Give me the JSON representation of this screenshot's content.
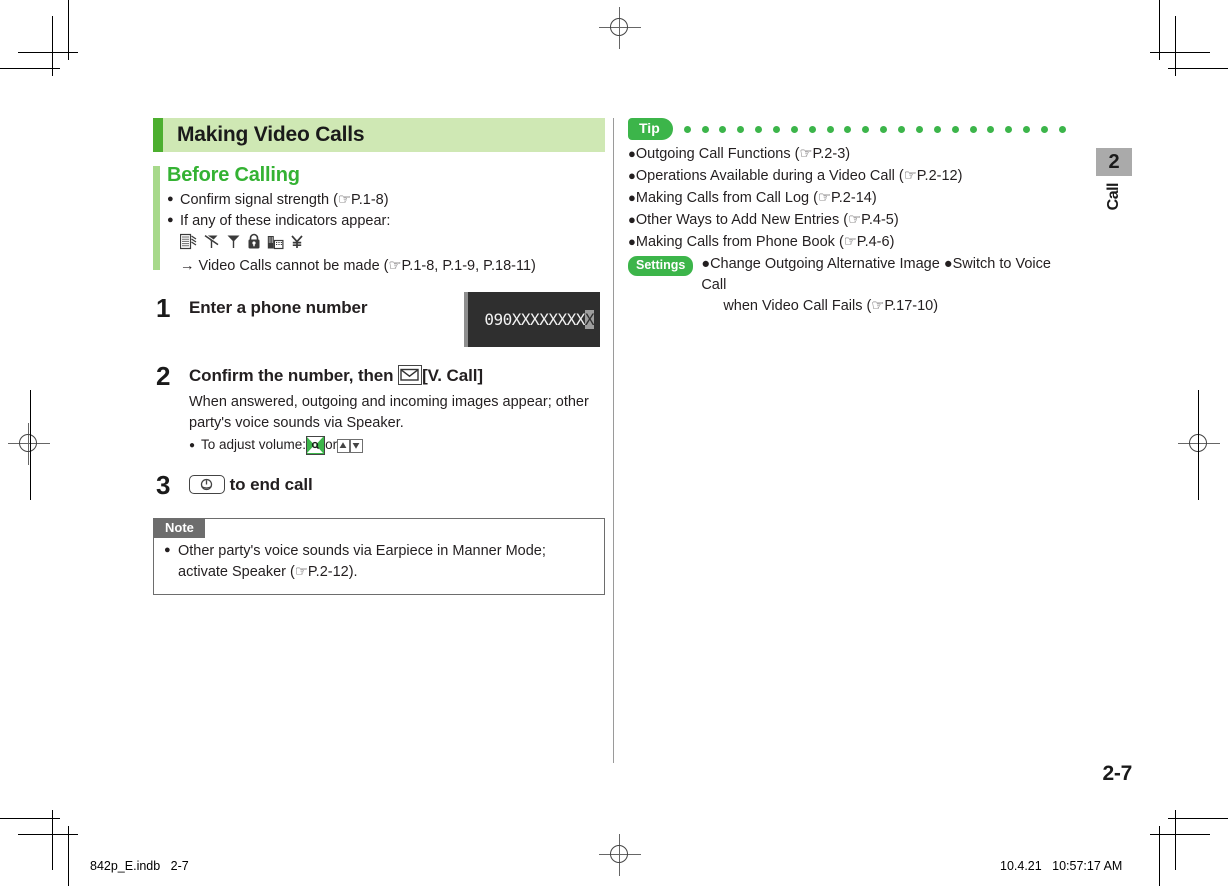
{
  "document": {
    "chapter_number": "2",
    "chapter_name": "Call",
    "folio": "2-7",
    "slug_left": "842p_E.indb   2-7",
    "slug_right": "10.4.21   10:57:17 AM"
  },
  "colors": {
    "accent_green": "#3cb54a",
    "header_band": "#cfe8b4",
    "header_stripe": "#4caf2f",
    "subsection_stripe": "#a7d98b",
    "heading_green": "#34b233",
    "note_gray": "#6d6d6d",
    "tab_gray": "#aaaaaa"
  },
  "section": {
    "title": "Making Video Calls"
  },
  "before_calling": {
    "heading": "Before Calling",
    "bullets": [
      "Confirm signal strength (☞P.1-8)",
      "If any of these indicators appear:"
    ],
    "indicators": [
      "no-service-icon",
      "antenna-crossed-icon",
      "antenna-icon",
      "lock-icon",
      "roaming-building-icon",
      "yen-icon"
    ],
    "result_line": "→ Video Calls cannot be made (☞P.1-8, P.1-9, P.18-11)"
  },
  "steps": [
    {
      "number": "1",
      "heading": "Enter a phone number",
      "body": "",
      "sub_bullets": []
    },
    {
      "number": "2",
      "heading_prefix": "Confirm the number, then ",
      "heading_key": "mail-key-icon",
      "heading_suffix": "[V. Call]",
      "body": "When answered, outgoing and incoming images appear; other party's voice sounds via Speaker.",
      "sub_bullets": [
        {
          "prefix": "To adjust volume: ",
          "key1": "nav-key-icon",
          "middle": " or ",
          "key2": "volume-up-key-icon",
          "key3": "volume-down-key-icon"
        }
      ]
    },
    {
      "number": "3",
      "heading_key": "end-call-key-icon",
      "heading_suffix": " to end call",
      "body": "",
      "sub_bullets": []
    }
  ],
  "screenshot": {
    "display_number": "090XXXXXXXX",
    "cursor_char": "X"
  },
  "note": {
    "label": "Note",
    "items": [
      "Other party's voice sounds via Earpiece in Manner Mode; activate Speaker (☞P.2-12)."
    ]
  },
  "tip": {
    "label": "Tip",
    "dot_count": 22,
    "items": [
      "Outgoing Call Functions (☞P.2-3)",
      "Operations Available during a Video Call (☞P.2-12)",
      "Making Calls from Call Log (☞P.2-14)",
      "Other Ways to Add New Entries (☞P.4-5)",
      "Making Calls from Phone Book (☞P.4-6)"
    ],
    "settings": {
      "badge": "Settings",
      "line1": "●Change Outgoing Alternative Image ●Switch to Voice Call",
      "line2": "when Video Call Fails (☞P.17-10)"
    }
  }
}
